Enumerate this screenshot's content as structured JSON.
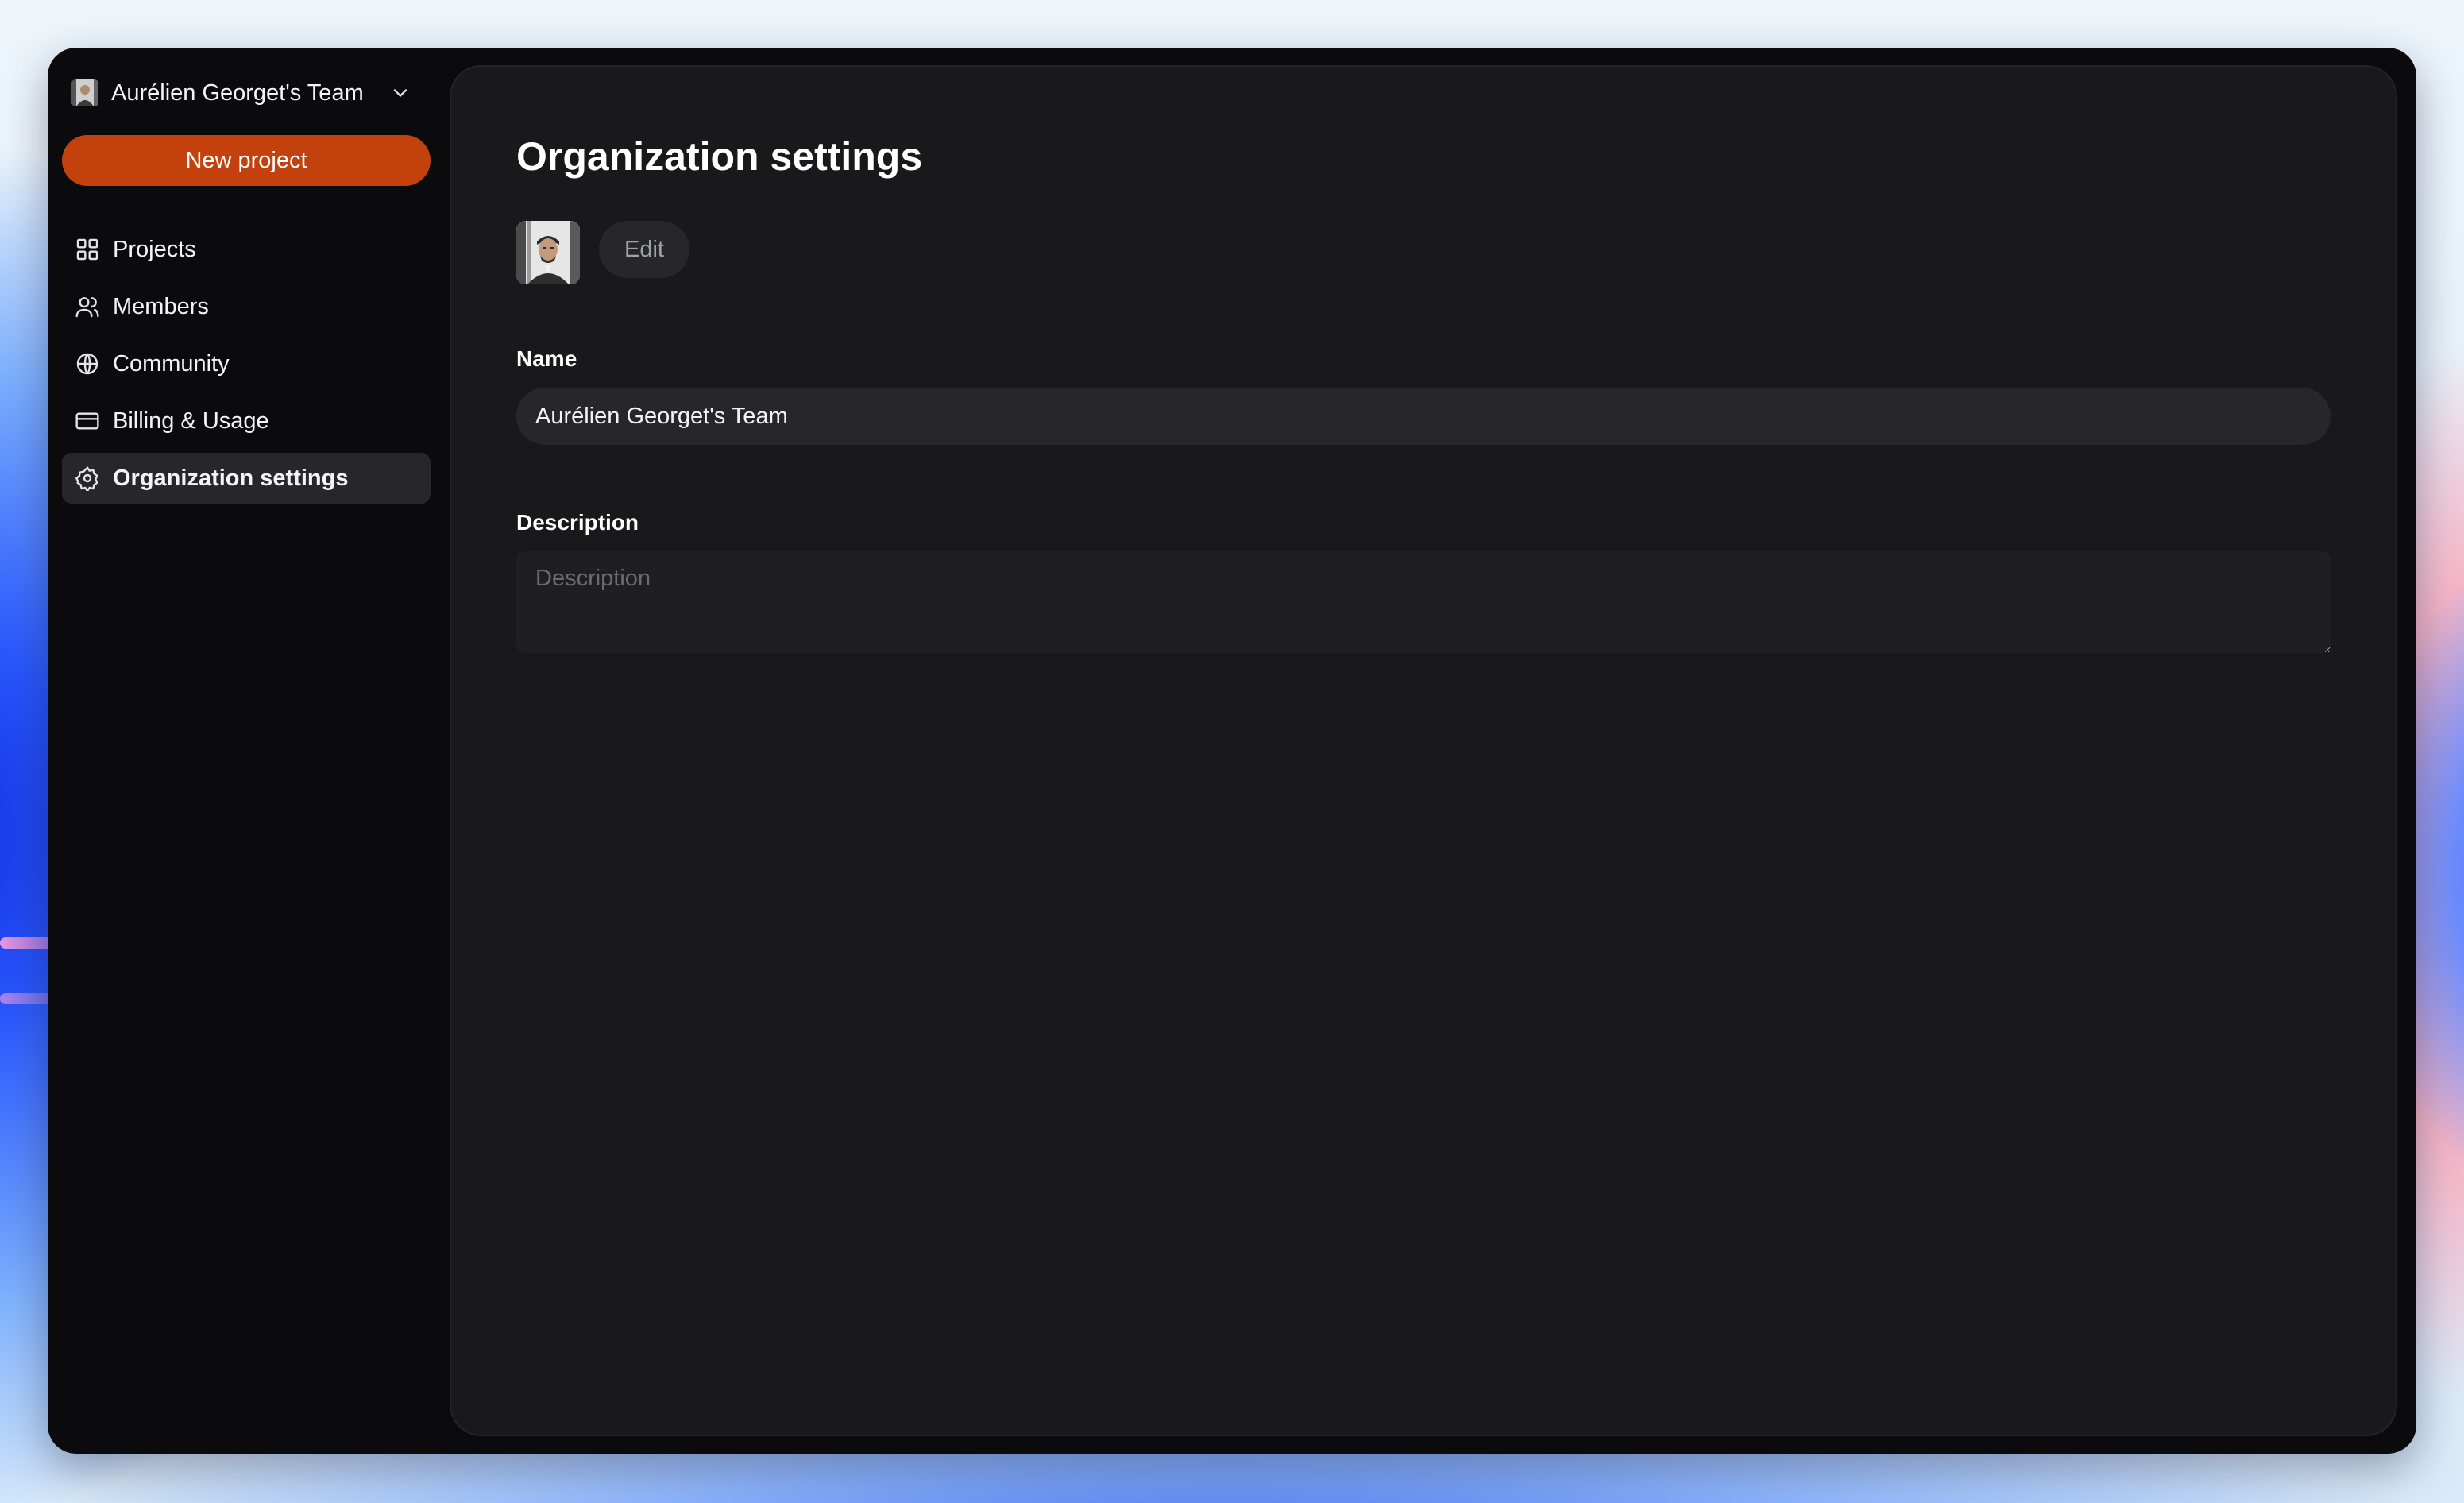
{
  "sidebar": {
    "team_name": "Aurélien Georget's Team",
    "new_project_label": "New project",
    "items": [
      {
        "label": "Projects",
        "icon": "grid-icon"
      },
      {
        "label": "Members",
        "icon": "users-icon"
      },
      {
        "label": "Community",
        "icon": "globe-icon"
      },
      {
        "label": "Billing & Usage",
        "icon": "credit-card-icon"
      },
      {
        "label": "Organization settings",
        "icon": "gear-icon",
        "active": true
      }
    ]
  },
  "main": {
    "title": "Organization settings",
    "edit_label": "Edit",
    "name_label": "Name",
    "name_value": "Aurélien Georget's Team",
    "description_label": "Description",
    "description_placeholder": "Description",
    "description_value": ""
  },
  "colors": {
    "accent": "#c2410c",
    "sidebar_bg": "#0b0b0d",
    "panel_bg": "#19191c",
    "active_item_bg": "#27272a"
  }
}
